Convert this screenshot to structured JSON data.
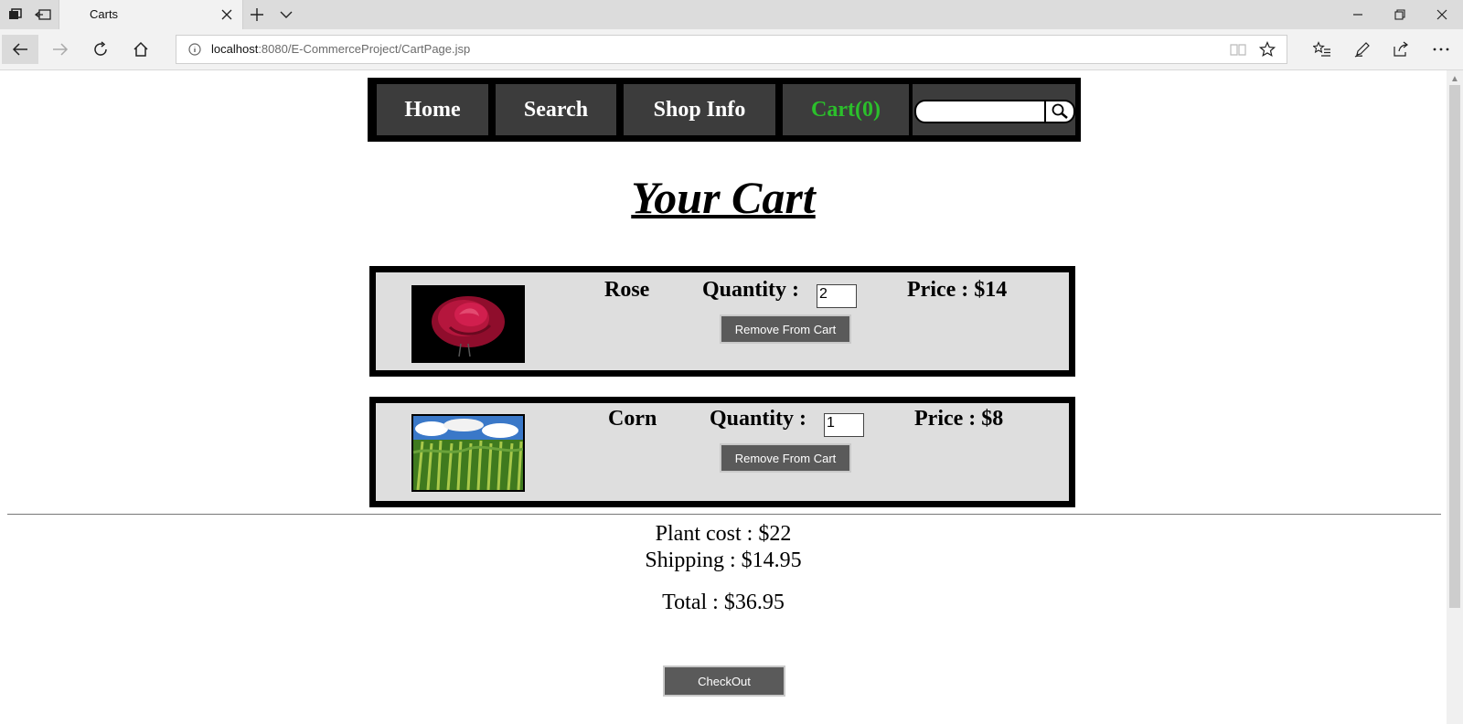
{
  "browser": {
    "tab_title": "Carts",
    "url_host": "localhost",
    "url_rest": ":8080/E-CommerceProject/CartPage.jsp"
  },
  "menu": {
    "home": "Home",
    "search": "Search",
    "shop_info": "Shop Info",
    "cart": "Cart(0)",
    "search_value": ""
  },
  "page": {
    "title": "Your Cart"
  },
  "cart_items": [
    {
      "name": "Rose",
      "quantity_label": "Quantity :",
      "quantity": "2",
      "price": "Price : $14",
      "remove_label": "Remove From Cart",
      "image": "rose-image"
    },
    {
      "name": "Corn",
      "quantity_label": "Quantity :",
      "quantity": "1",
      "price": "Price : $8",
      "remove_label": "Remove From Cart",
      "image": "corn-image"
    }
  ],
  "summary": {
    "plant_cost": "Plant cost : $22",
    "shipping": "Shipping : $14.95",
    "total": "Total : $36.95"
  },
  "checkout_label": "CheckOut",
  "colors": {
    "menu_bg": "#3c3c3c",
    "cart_link": "#2bc02b",
    "item_bg": "#dedede",
    "button_bg": "#5a5a5a"
  }
}
